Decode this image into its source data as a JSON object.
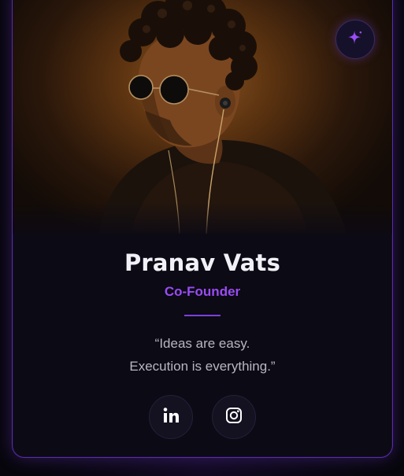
{
  "profile": {
    "name": "Pranav Vats",
    "role": "Co-Founder",
    "quote_line1": "“Ideas are easy.",
    "quote_line2": "Execution is everything.”"
  },
  "icons": {
    "badge": "sparkle-icon",
    "social": [
      "linkedin-icon",
      "instagram-icon"
    ]
  },
  "colors": {
    "accent": "#9a4cf5",
    "card_border": "#5b2bb0",
    "background": "#07060c",
    "text": "#f2f0f7"
  }
}
